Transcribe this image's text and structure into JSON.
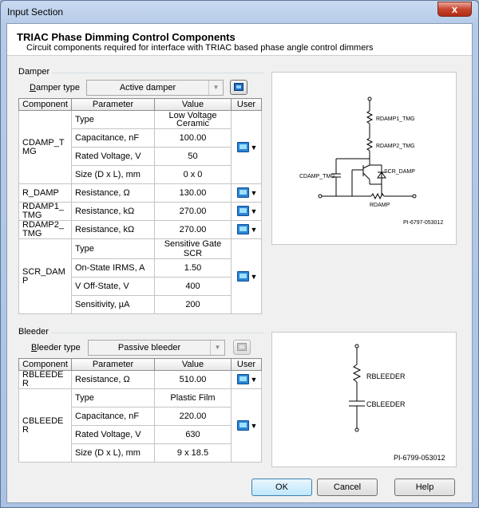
{
  "window": {
    "title": "Input Section",
    "close_label": "x"
  },
  "header": {
    "title": "TRIAC Phase Dimming Control Components",
    "subtitle": "Circuit components required for interface with TRIAC based phase angle control dimmers"
  },
  "damper": {
    "group_label": "Damper",
    "type_label": "Damper type",
    "type_value": "Active damper",
    "columns": [
      "Component",
      "Parameter",
      "Value",
      "User"
    ],
    "rows": [
      {
        "component": "CDAMP_TMG",
        "params": [
          {
            "name": "Type",
            "value": "Low Voltage Ceramic"
          },
          {
            "name": "Capacitance, nF",
            "value": "100.00"
          },
          {
            "name": "Rated Voltage, V",
            "value": "50"
          },
          {
            "name": "Size (D x L), mm",
            "value": "0 x 0"
          }
        ]
      },
      {
        "component": "R_DAMP",
        "params": [
          {
            "name": "Resistance, Ω",
            "value": "130.00"
          }
        ]
      },
      {
        "component": "RDAMP1_TMG",
        "params": [
          {
            "name": "Resistance, kΩ",
            "value": "270.00"
          }
        ]
      },
      {
        "component": "RDAMP2_TMG",
        "params": [
          {
            "name": "Resistance, kΩ",
            "value": "270.00"
          }
        ]
      },
      {
        "component": "SCR_DAMP",
        "params": [
          {
            "name": "Type",
            "value": "Sensitive Gate SCR"
          },
          {
            "name": "On-State IRMS, A",
            "value": "1.50"
          },
          {
            "name": "V Off-State, V",
            "value": "400"
          },
          {
            "name": "Sensitivity, µA",
            "value": "200"
          }
        ]
      }
    ],
    "schematic": {
      "labels": [
        "RDAMP1_TMG",
        "RDAMP2_TMG",
        "CDAMP_TMG",
        "SCR_DAMP",
        "RDAMP"
      ],
      "code": "PI-6797-053012"
    }
  },
  "bleeder": {
    "group_label": "Bleeder",
    "type_label": "Bleeder type",
    "type_value": "Passive bleeder",
    "columns": [
      "Component",
      "Parameter",
      "Value",
      "User"
    ],
    "rows": [
      {
        "component": "RBLEEDER",
        "params": [
          {
            "name": "Resistance, Ω",
            "value": "510.00"
          }
        ]
      },
      {
        "component": "CBLEEDER",
        "params": [
          {
            "name": "Type",
            "value": "Plastic Film"
          },
          {
            "name": "Capacitance, nF",
            "value": "220.00"
          },
          {
            "name": "Rated Voltage, V",
            "value": "630"
          },
          {
            "name": "Size (D x L), mm",
            "value": "9 x 18.5"
          }
        ]
      }
    ],
    "schematic": {
      "labels": [
        "RBLEEDER",
        "CBLEEDER"
      ],
      "code": "PI-6799-053012"
    }
  },
  "buttons": {
    "ok": "OK",
    "cancel": "Cancel",
    "help": "Help"
  }
}
